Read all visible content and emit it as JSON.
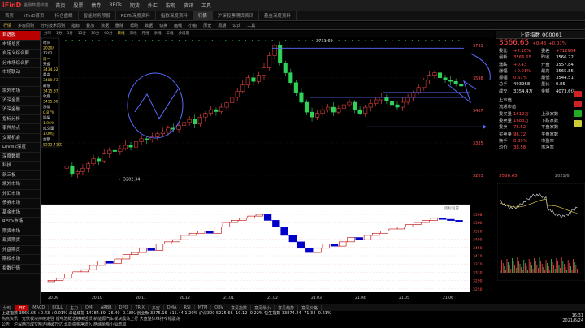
{
  "app": {
    "logo": "iFinD",
    "logo_sub": "金融数据终端"
  },
  "menu": [
    "首页",
    "股票",
    "债券",
    "REITs",
    "期货",
    "外汇",
    "宏观",
    "资讯",
    "工具"
  ],
  "tabs": [
    "首页",
    "iFinD首页",
    "持仓盘眼",
    "智能财务预报",
    "REITs深度资料",
    "指数深度资料",
    "行情",
    "沪深股票期货资讯",
    "基金深度资料"
  ],
  "active_tab": "行情",
  "toolbar": [
    "行情",
    "多窗同列",
    "分时技术同列",
    "指标",
    "叠加",
    "数据",
    "删除",
    "帮助",
    "数据",
    "切换",
    "画线",
    "小窗",
    "历史",
    "周期",
    "公式",
    "工具"
  ],
  "sidebar": [
    "自选股",
    "市场总览",
    "自定义综合屏",
    "分市场综合屏",
    "市场联动",
    "",
    "境外市场",
    "沪深全景",
    "沪深金融",
    "指标分析",
    "事件热点",
    "交易机会",
    "Level2深度",
    "深度数据",
    "科技",
    "新三板",
    "境外市场",
    "外汇市场",
    "债券市场",
    "基金市场",
    "REITs市场",
    "期货市场",
    "现货期货",
    "外盘期货",
    "期权市场",
    "指数行情"
  ],
  "sub_tabs": [
    "分时",
    "1分",
    "5分",
    "15分",
    "30分",
    "60分",
    "日线",
    "周线",
    "月线",
    "季线",
    "年线",
    "多周期"
  ],
  "data_panel": [
    "时间",
    "2020/",
    "1202",
    "周一",
    "开盘",
    "3434.52",
    "最高",
    "3480.73",
    "最低",
    "3415.87",
    "收盘",
    "3455.00",
    "涨幅",
    "0.87%",
    "振幅",
    "1.96%",
    "成交量",
    "1.00亿",
    "金额",
    "5222.41亿"
  ],
  "chart_labels": {
    "high_label": "3731.69",
    "low_label": "3202.34",
    "upper_axis": [
      "3731",
      "3598",
      "3467",
      "3335",
      "3203"
    ],
    "lower_axis": [
      "3598",
      "3560",
      "3520",
      "3490",
      "3450",
      "3410",
      "3370",
      "3330",
      "3290",
      "3250"
    ],
    "time_axis": [
      "20.09",
      "20.10",
      "20.11",
      "20.12",
      "21.01",
      "21.02",
      "21.03",
      "21.04",
      "21.05",
      "21.06"
    ],
    "ind_label": "指标设置"
  },
  "chart_data": {
    "type": "candlestick",
    "upper_close": [
      3242,
      3210,
      3218,
      3232,
      3250,
      3270,
      3262,
      3290,
      3305,
      3300,
      3312,
      3325,
      3318,
      3340,
      3352,
      3348,
      3360,
      3372,
      3380,
      3395,
      3390,
      3405,
      3418,
      3430,
      3412,
      3440,
      3455,
      3470,
      3462,
      3480,
      3498,
      3520,
      3545,
      3570,
      3600,
      3585,
      3610,
      3640,
      3690,
      3731,
      3660,
      3620,
      3580,
      3540,
      3500,
      3460,
      3440,
      3455,
      3470,
      3480,
      3460,
      3475,
      3490,
      3500,
      3470,
      3455,
      3480,
      3495,
      3510,
      3520,
      3505,
      3490,
      3480,
      3500,
      3520,
      3540,
      3560,
      3590,
      3610,
      3620,
      3600,
      3590,
      3585,
      3575,
      3566
    ],
    "lower_close": [
      3290,
      3300,
      3320,
      3330,
      3340,
      3360,
      3380,
      3370,
      3390,
      3410,
      3420,
      3440,
      3430,
      3460,
      3470,
      3480,
      3500,
      3510,
      3520,
      3510,
      3540,
      3560,
      3570,
      3580,
      3590,
      3598,
      3570,
      3540,
      3500,
      3470,
      3440,
      3420,
      3440,
      3460,
      3450,
      3470,
      3490,
      3480,
      3500,
      3510,
      3520,
      3530,
      3540,
      3550,
      3560,
      3570,
      3580,
      3575,
      3570,
      3566
    ]
  },
  "quote": {
    "title": "上证指数 000001",
    "price": "3566.65",
    "change": "+0.43",
    "pct": "+0.01%",
    "rows": [
      [
        "委比",
        "+2.16%",
        "委差",
        "+712964"
      ],
      [
        "最新",
        "3566.65",
        "昨收",
        "3566.22"
      ],
      [
        "涨跌",
        "+0.43",
        "开盘",
        "3557.84"
      ],
      [
        "涨幅",
        "+0.01%",
        "最高",
        "3565.85"
      ],
      [
        "振幅",
        "0.61%",
        "最低",
        "3544.51"
      ],
      [
        "总手",
        "493968",
        "量比",
        "0.85"
      ],
      [
        "成交",
        "3354.4万",
        "金额",
        "4073.6亿"
      ]
    ],
    "rows2": [
      [
        "上市值",
        "",
        ""
      ],
      [
        "流通市值",
        "",
        ""
      ],
      [
        "委买量",
        "1612万",
        "上涨家数"
      ],
      [
        "委卖量",
        "1683万",
        "下跌家数"
      ],
      [
        "委卖",
        "76.52",
        "平盘家数"
      ],
      [
        "买卖量",
        "96.72",
        "平盘家数"
      ],
      [
        "换手",
        "0.89%",
        "市盈率"
      ],
      [
        "均价",
        "38.58",
        "市净率"
      ]
    ],
    "mini_price": "3566.65",
    "mini_label": "2021/6"
  },
  "bottom_tabs": [
    "分时",
    "日K",
    "MACD",
    "BOLL",
    "主力",
    "DMI",
    "ARBR",
    "DPO",
    "TRIX",
    "多空",
    "DMA",
    "RSI",
    "MTM",
    "OBV",
    "意见指数",
    "意见最小",
    "意见趋势",
    "意见价格"
  ],
  "ticker": [
    "上证指数 3566.65 +0.43 +0.01% 深证成指 14784.89 -26.40 -0.18% 创业板 3275.16 +15.44 1.20% 沪深300 5225.66 -10.12 -0.22% 恒生指数 33874.24 -71.34 -0.21%",
    "热点资讯：光伏板块持续走强 锂电池概念继续活跃 新能源汽车板块震荡上行 大盘整体维持窄幅震荡",
    "公告：沪深两市成交额连续破万亿 北向资金净流入 两融余额小幅增加"
  ],
  "clock": {
    "time": "16:31",
    "date": "2021/6/24"
  },
  "colors": {
    "up": "#ff4a4a",
    "down": "#2fd35a",
    "bg": "#000000"
  }
}
